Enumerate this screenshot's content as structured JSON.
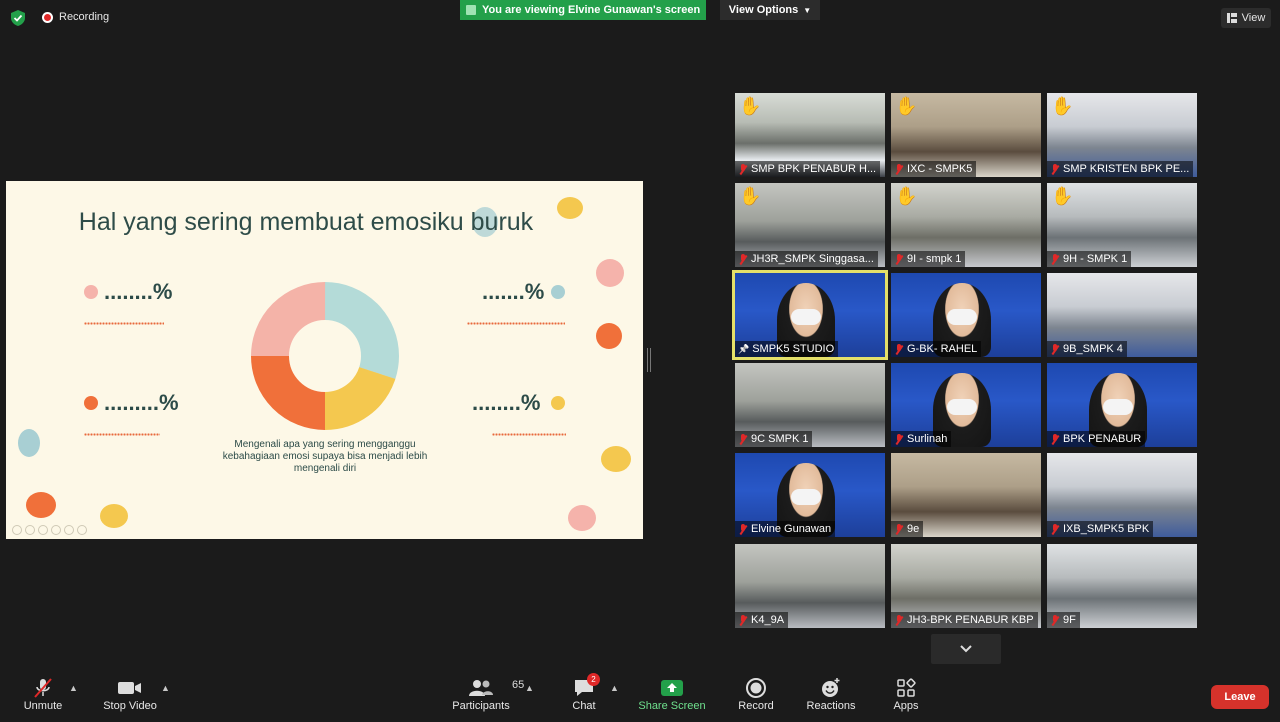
{
  "top": {
    "recording_label": "Recording",
    "viewing_banner": "You are viewing Elvine Gunawan's screen",
    "view_options_label": "View Options",
    "view_label": "View"
  },
  "slide": {
    "title": "Hal yang sering membuat emosiku buruk",
    "percent_top_left": "........%",
    "percent_top_right": ".......%",
    "percent_bottom_left": ".........%",
    "percent_bottom_right": "........%",
    "caption": "Mengenali apa yang sering mengganggu kebahagiaan emosi supaya bisa menjadi lebih mengenali diri",
    "donut_colors": [
      "#b4dbd8",
      "#f4c84f",
      "#f0703a",
      "#f4b3a8"
    ]
  },
  "participants": [
    {
      "name": "SMP BPK PENABUR H...",
      "raised_hand": true
    },
    {
      "name": "IXC - SMPK5",
      "raised_hand": true
    },
    {
      "name": "SMP KRISTEN BPK PE...",
      "raised_hand": true
    },
    {
      "name": "JH3R_SMPK Singgasa...",
      "raised_hand": true
    },
    {
      "name": "9I - smpk 1",
      "raised_hand": true
    },
    {
      "name": "9H - SMPK 1",
      "raised_hand": true
    },
    {
      "name": "SMPK5 STUDIO",
      "raised_hand": false,
      "active": true
    },
    {
      "name": "G-BK- RAHEL",
      "raised_hand": false
    },
    {
      "name": "9B_SMPK 4",
      "raised_hand": false
    },
    {
      "name": "9C SMPK 1",
      "raised_hand": false
    },
    {
      "name": "Surlinah",
      "raised_hand": false
    },
    {
      "name": "BPK PENABUR",
      "raised_hand": false
    },
    {
      "name": "Elvine Gunawan",
      "raised_hand": false
    },
    {
      "name": "9e",
      "raised_hand": false
    },
    {
      "name": "IXB_SMPK5 BPK",
      "raised_hand": false
    },
    {
      "name": "K4_9A",
      "raised_hand": false
    },
    {
      "name": "JH3-BPK PENABUR KBP",
      "raised_hand": false
    },
    {
      "name": "9F",
      "raised_hand": false
    }
  ],
  "toolbar": {
    "unmute": "Unmute",
    "stop_video": "Stop Video",
    "participants": "Participants",
    "participants_count": "65",
    "chat": "Chat",
    "chat_badge": "2",
    "share_screen": "Share Screen",
    "record": "Record",
    "reactions": "Reactions",
    "apps": "Apps",
    "leave": "Leave"
  },
  "colors": {
    "accent_green": "#23a04a",
    "leave_red": "#d6322b",
    "active_speaker": "#e4e069"
  }
}
